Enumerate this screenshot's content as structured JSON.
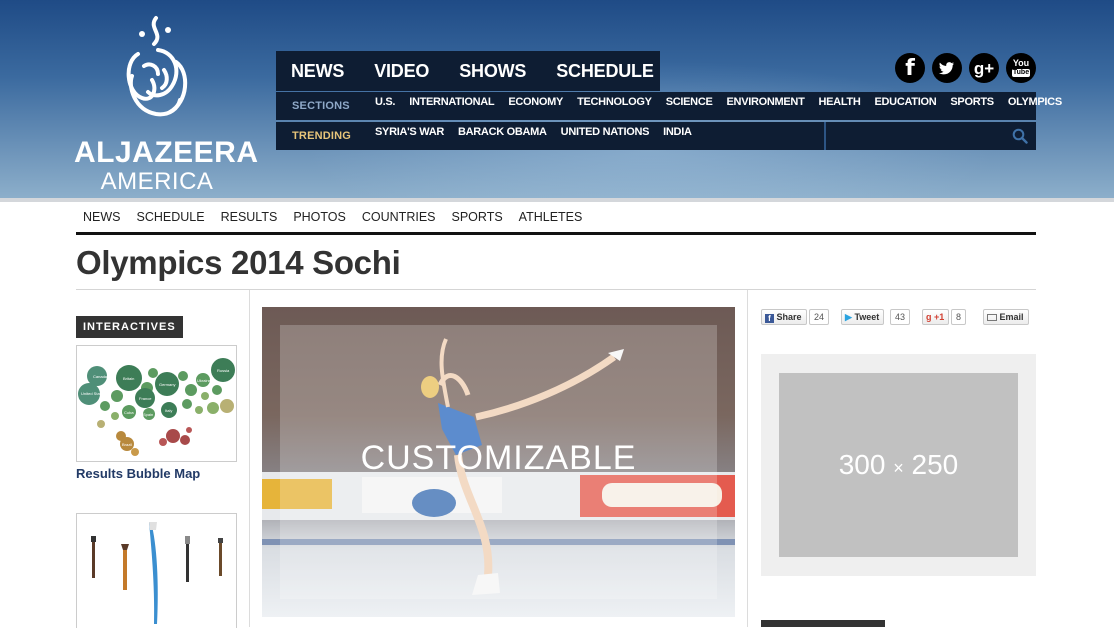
{
  "brand": {
    "name": "ALJAZEERA",
    "sub": "AMERICA"
  },
  "main_nav": [
    "NEWS",
    "VIDEO",
    "SHOWS",
    "SCHEDULE"
  ],
  "sections": {
    "label": "SECTIONS",
    "items": [
      "U.S.",
      "INTERNATIONAL",
      "ECONOMY",
      "TECHNOLOGY",
      "SCIENCE",
      "ENVIRONMENT",
      "HEALTH",
      "EDUCATION",
      "SPORTS",
      "OLYMPICS"
    ]
  },
  "trending": {
    "label": "TRENDING",
    "items": [
      "SYRIA'S WAR",
      "BARACK OBAMA",
      "UNITED NATIONS",
      "INDIA"
    ]
  },
  "social": {
    "facebook": "f",
    "googleplus": "g+",
    "youtube_top": "You",
    "youtube_bottom": "Tube"
  },
  "olympic_nav": [
    "NEWS",
    "SCHEDULE",
    "RESULTS",
    "PHOTOS",
    "COUNTRIES",
    "SPORTS",
    "ATHLETES"
  ],
  "page_title": "Olympics 2014 Sochi",
  "left": {
    "section_label": "INTERACTIVES",
    "bubble_map_caption": "Results Bubble Map",
    "bubble_labels": [
      "Canada",
      "United States",
      "Britain",
      "Germany",
      "France",
      "Russia",
      "Ukraine",
      "Spain",
      "Italy",
      "Cuba",
      "Brazil"
    ]
  },
  "feature": {
    "label": "CUSTOMIZABLE"
  },
  "share": {
    "facebook": {
      "label": "Share",
      "count": "24"
    },
    "twitter": {
      "label": "Tweet",
      "count": "43"
    },
    "googleplus": {
      "label": "+1",
      "count": "8"
    },
    "email": {
      "label": "Email"
    }
  },
  "ad": {
    "width": "300",
    "x": "×",
    "height": "250"
  }
}
